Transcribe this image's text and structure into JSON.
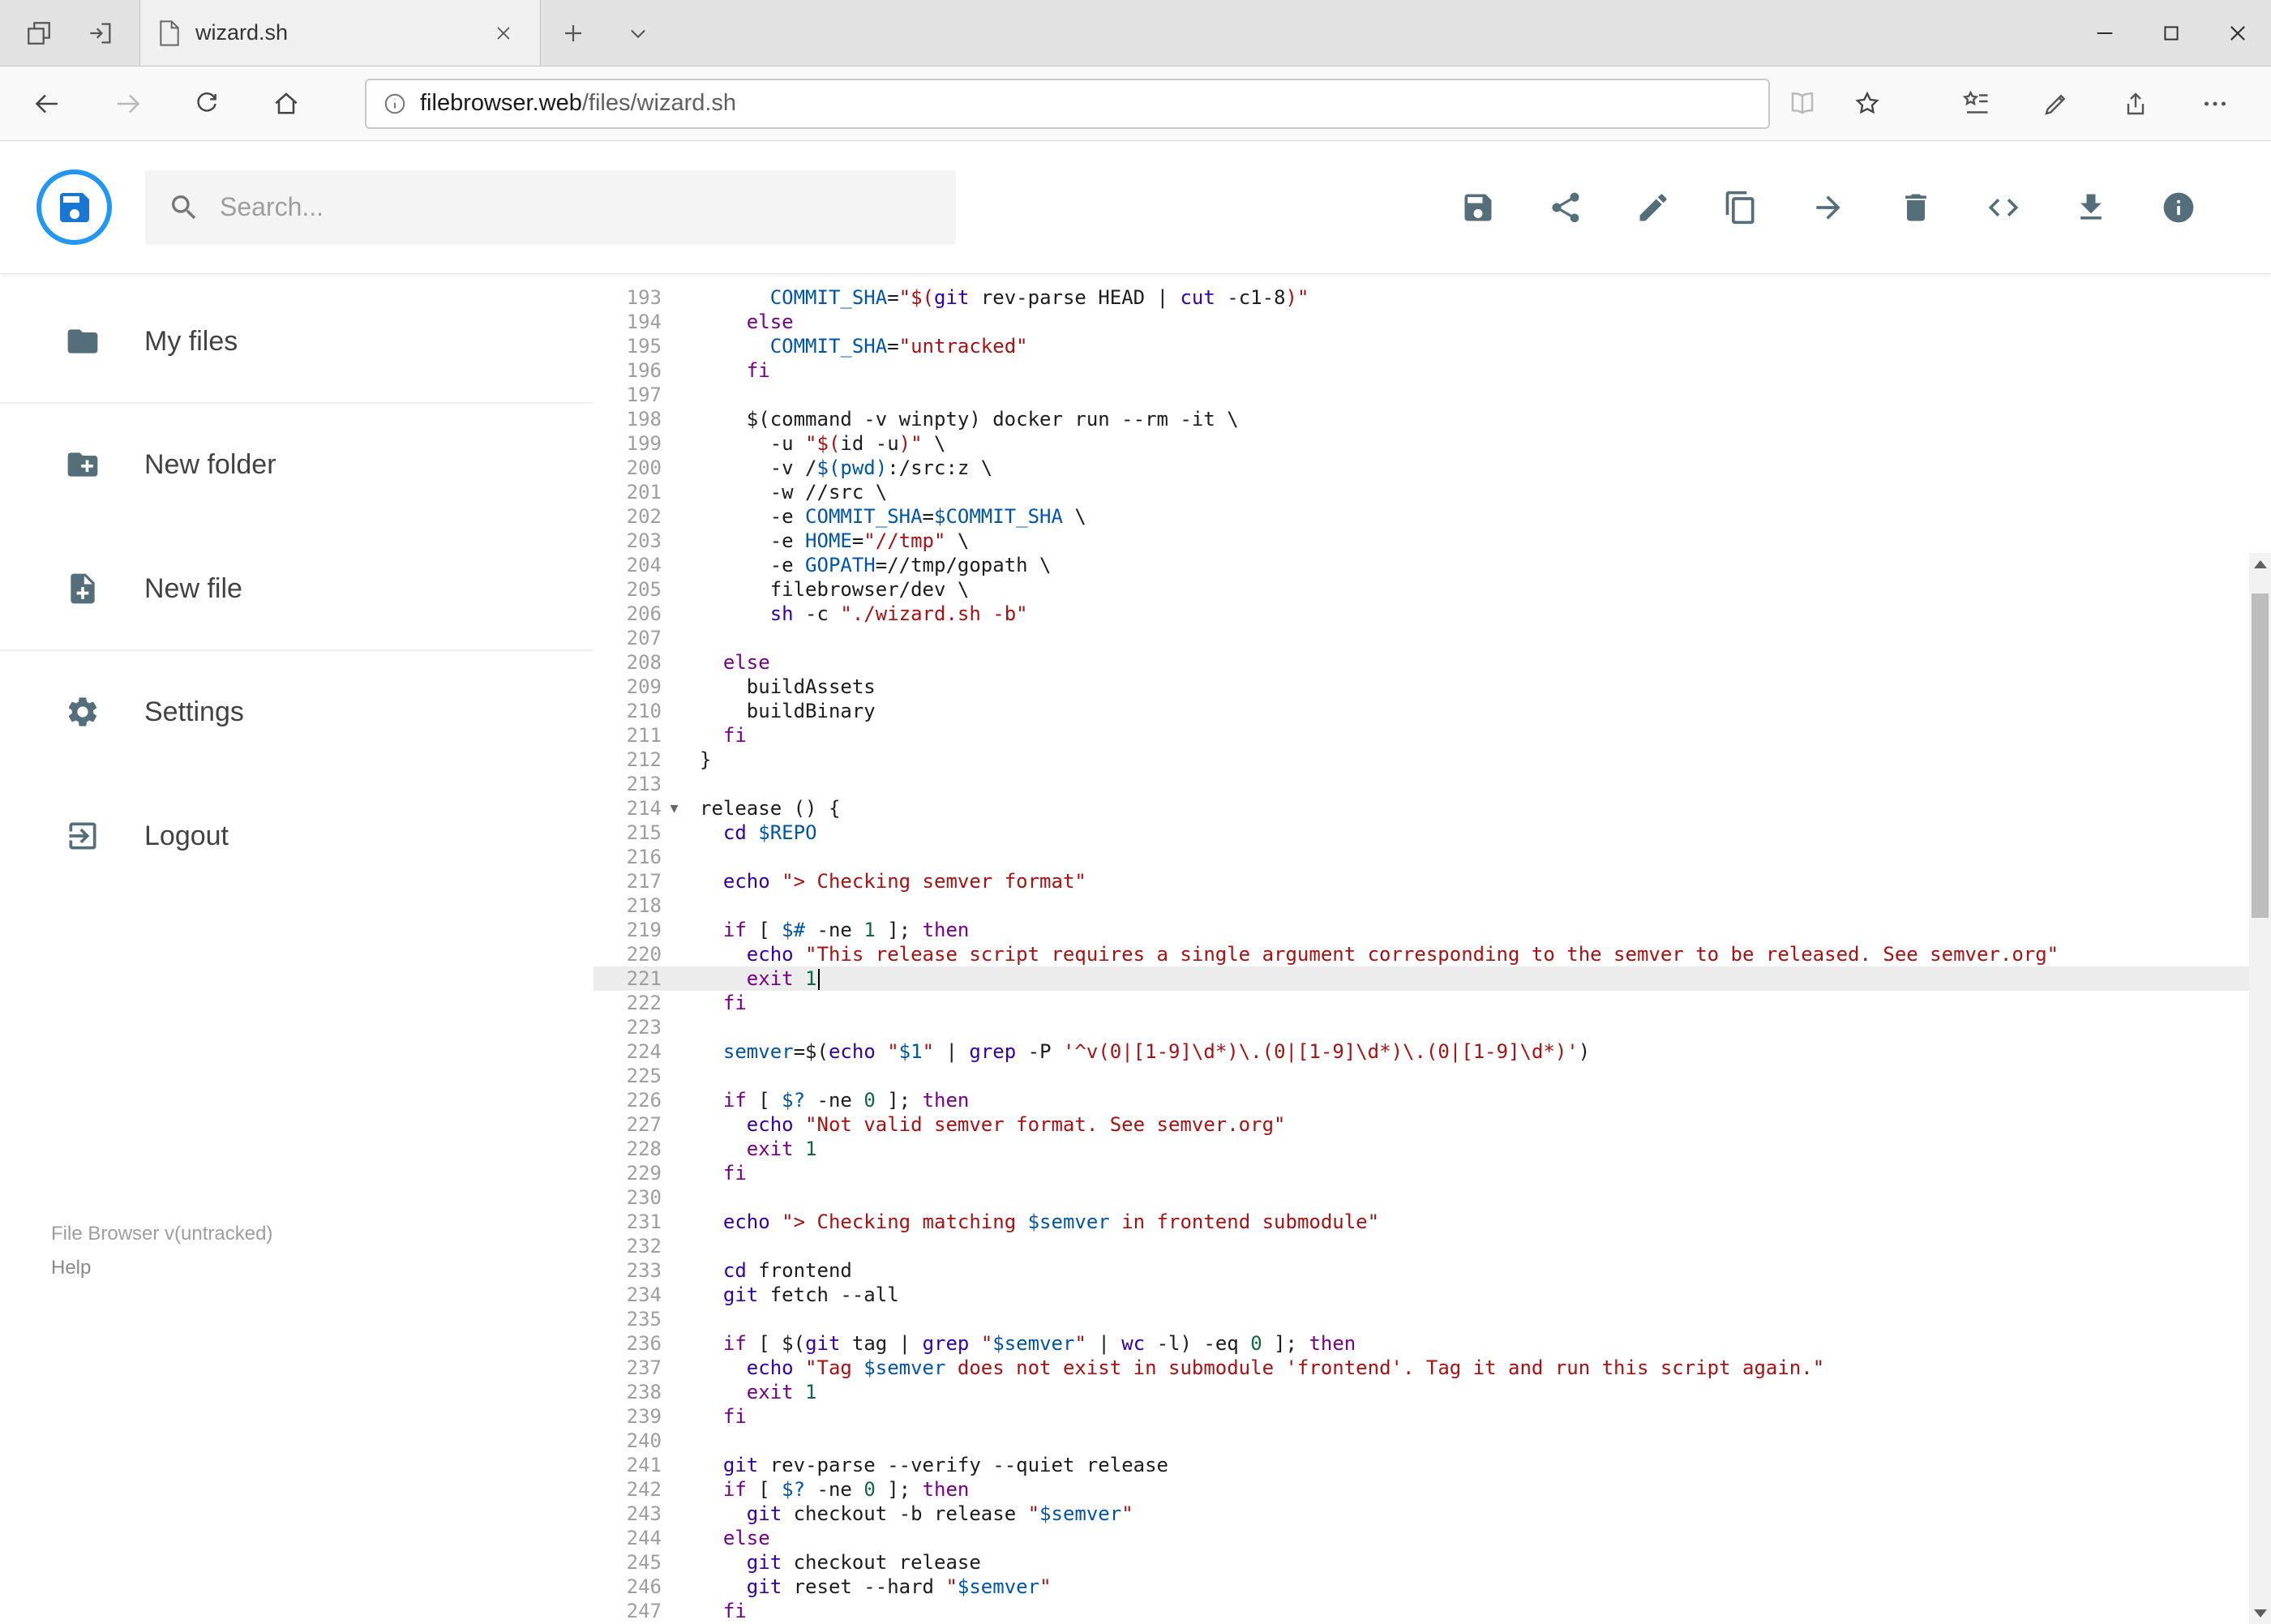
{
  "browser": {
    "tab_title": "wizard.sh",
    "url_domain": "filebrowser.web",
    "url_path": "/files/wizard.sh",
    "window_buttons": [
      "minimize",
      "maximize",
      "close"
    ],
    "nav_buttons": [
      "back",
      "forward",
      "refresh",
      "home"
    ],
    "right_buttons": [
      "reading-view",
      "add-favorite",
      "hub-favorites",
      "web-note",
      "share",
      "more"
    ]
  },
  "header": {
    "search_placeholder": "Search...",
    "actions": [
      "save",
      "share",
      "edit",
      "copy",
      "move",
      "delete",
      "view-source",
      "download",
      "info"
    ],
    "accent_color": "#2196f3",
    "icon_color": "#546e7a"
  },
  "sidebar": {
    "items": [
      {
        "label": "My files",
        "icon": "folder"
      },
      {
        "label": "New folder",
        "icon": "create-new-folder"
      },
      {
        "label": "New file",
        "icon": "new-file"
      },
      {
        "label": "Settings",
        "icon": "settings"
      },
      {
        "label": "Logout",
        "icon": "logout"
      }
    ],
    "version": "File Browser v(untracked)",
    "help": "Help"
  },
  "editor": {
    "language": "shell",
    "active_line": 221,
    "cursor_line": 221,
    "fold_marker": "▾",
    "lines": [
      {
        "n": 193,
        "tokens": [
          [
            "pl",
            "      "
          ],
          [
            "var",
            "COMMIT_SHA"
          ],
          [
            "pl",
            "="
          ],
          [
            "str",
            "\"$("
          ],
          [
            "bi",
            "git"
          ],
          [
            "pl",
            " rev-parse HEAD | "
          ],
          [
            "bi",
            "cut"
          ],
          [
            "pl",
            " -c1-8"
          ],
          [
            "str",
            ")\""
          ]
        ]
      },
      {
        "n": 194,
        "tokens": [
          [
            "pl",
            "    "
          ],
          [
            "kw",
            "else"
          ]
        ]
      },
      {
        "n": 195,
        "tokens": [
          [
            "pl",
            "      "
          ],
          [
            "var",
            "COMMIT_SHA"
          ],
          [
            "pl",
            "="
          ],
          [
            "str",
            "\"untracked\""
          ]
        ]
      },
      {
        "n": 196,
        "tokens": [
          [
            "pl",
            "    "
          ],
          [
            "kw",
            "fi"
          ]
        ]
      },
      {
        "n": 197,
        "tokens": []
      },
      {
        "n": 198,
        "tokens": [
          [
            "pl",
            "    $(command -v winpty) docker run --rm -it \\"
          ]
        ]
      },
      {
        "n": 199,
        "tokens": [
          [
            "pl",
            "      -u "
          ],
          [
            "str",
            "\"$("
          ],
          [
            "pl",
            "id -u"
          ],
          [
            "str",
            ")\""
          ],
          [
            "pl",
            " \\"
          ]
        ]
      },
      {
        "n": 200,
        "tokens": [
          [
            "pl",
            "      -v /"
          ],
          [
            "var",
            "$(pwd)"
          ],
          [
            "pl",
            ":/src:z \\"
          ]
        ]
      },
      {
        "n": 201,
        "tokens": [
          [
            "pl",
            "      -w //src \\"
          ]
        ]
      },
      {
        "n": 202,
        "tokens": [
          [
            "pl",
            "      -e "
          ],
          [
            "var",
            "COMMIT_SHA"
          ],
          [
            "pl",
            "="
          ],
          [
            "var",
            "$COMMIT_SHA"
          ],
          [
            "pl",
            " \\"
          ]
        ]
      },
      {
        "n": 203,
        "tokens": [
          [
            "pl",
            "      -e "
          ],
          [
            "var",
            "HOME"
          ],
          [
            "pl",
            "="
          ],
          [
            "str",
            "\"//tmp\""
          ],
          [
            "pl",
            " \\"
          ]
        ]
      },
      {
        "n": 204,
        "tokens": [
          [
            "pl",
            "      -e "
          ],
          [
            "var",
            "GOPATH"
          ],
          [
            "pl",
            "=//tmp/gopath \\"
          ]
        ]
      },
      {
        "n": 205,
        "tokens": [
          [
            "pl",
            "      filebrowser/dev \\"
          ]
        ]
      },
      {
        "n": 206,
        "tokens": [
          [
            "pl",
            "      "
          ],
          [
            "bi",
            "sh"
          ],
          [
            "pl",
            " -c "
          ],
          [
            "str",
            "\"./wizard.sh -b\""
          ]
        ]
      },
      {
        "n": 207,
        "tokens": []
      },
      {
        "n": 208,
        "tokens": [
          [
            "pl",
            "  "
          ],
          [
            "kw",
            "else"
          ]
        ]
      },
      {
        "n": 209,
        "tokens": [
          [
            "pl",
            "    buildAssets"
          ]
        ]
      },
      {
        "n": 210,
        "tokens": [
          [
            "pl",
            "    buildBinary"
          ]
        ]
      },
      {
        "n": 211,
        "tokens": [
          [
            "pl",
            "  "
          ],
          [
            "kw",
            "fi"
          ]
        ]
      },
      {
        "n": 212,
        "tokens": [
          [
            "pl",
            "}"
          ]
        ]
      },
      {
        "n": 213,
        "tokens": []
      },
      {
        "n": 214,
        "fold": true,
        "tokens": [
          [
            "pl",
            "release () {"
          ]
        ]
      },
      {
        "n": 215,
        "tokens": [
          [
            "pl",
            "  "
          ],
          [
            "bi",
            "cd"
          ],
          [
            "pl",
            " "
          ],
          [
            "var",
            "$REPO"
          ]
        ]
      },
      {
        "n": 216,
        "tokens": []
      },
      {
        "n": 217,
        "tokens": [
          [
            "pl",
            "  "
          ],
          [
            "bi",
            "echo"
          ],
          [
            "pl",
            " "
          ],
          [
            "str",
            "\"> Checking semver format\""
          ]
        ]
      },
      {
        "n": 218,
        "tokens": []
      },
      {
        "n": 219,
        "tokens": [
          [
            "pl",
            "  "
          ],
          [
            "kw",
            "if"
          ],
          [
            "pl",
            " [ "
          ],
          [
            "var",
            "$#"
          ],
          [
            "pl",
            " -ne "
          ],
          [
            "num",
            "1"
          ],
          [
            "pl",
            " ]; "
          ],
          [
            "kw",
            "then"
          ]
        ]
      },
      {
        "n": 220,
        "tokens": [
          [
            "pl",
            "    "
          ],
          [
            "bi",
            "echo"
          ],
          [
            "pl",
            " "
          ],
          [
            "str",
            "\"This release script requires a single argument corresponding to the semver to be released. See semver.org\""
          ]
        ]
      },
      {
        "n": 221,
        "tokens": [
          [
            "pl",
            "    "
          ],
          [
            "kw",
            "exit"
          ],
          [
            "pl",
            " "
          ],
          [
            "num",
            "1"
          ]
        ]
      },
      {
        "n": 222,
        "tokens": [
          [
            "pl",
            "  "
          ],
          [
            "kw",
            "fi"
          ]
        ]
      },
      {
        "n": 223,
        "tokens": []
      },
      {
        "n": 224,
        "tokens": [
          [
            "pl",
            "  "
          ],
          [
            "var",
            "semver"
          ],
          [
            "pl",
            "=$("
          ],
          [
            "bi",
            "echo"
          ],
          [
            "pl",
            " "
          ],
          [
            "str",
            "\""
          ],
          [
            "var",
            "$1"
          ],
          [
            "str",
            "\""
          ],
          [
            "pl",
            " | "
          ],
          [
            "bi",
            "grep"
          ],
          [
            "pl",
            " -P "
          ],
          [
            "str",
            "'^v(0|[1-9]\\d*)\\.(0|[1-9]\\d*)\\.(0|[1-9]\\d*)'"
          ],
          [
            "pl",
            ")"
          ]
        ]
      },
      {
        "n": 225,
        "tokens": []
      },
      {
        "n": 226,
        "tokens": [
          [
            "pl",
            "  "
          ],
          [
            "kw",
            "if"
          ],
          [
            "pl",
            " [ "
          ],
          [
            "var",
            "$?"
          ],
          [
            "pl",
            " -ne "
          ],
          [
            "num",
            "0"
          ],
          [
            "pl",
            " ]; "
          ],
          [
            "kw",
            "then"
          ]
        ]
      },
      {
        "n": 227,
        "tokens": [
          [
            "pl",
            "    "
          ],
          [
            "bi",
            "echo"
          ],
          [
            "pl",
            " "
          ],
          [
            "str",
            "\"Not valid semver format. See semver.org\""
          ]
        ]
      },
      {
        "n": 228,
        "tokens": [
          [
            "pl",
            "    "
          ],
          [
            "kw",
            "exit"
          ],
          [
            "pl",
            " "
          ],
          [
            "num",
            "1"
          ]
        ]
      },
      {
        "n": 229,
        "tokens": [
          [
            "pl",
            "  "
          ],
          [
            "kw",
            "fi"
          ]
        ]
      },
      {
        "n": 230,
        "tokens": []
      },
      {
        "n": 231,
        "tokens": [
          [
            "pl",
            "  "
          ],
          [
            "bi",
            "echo"
          ],
          [
            "pl",
            " "
          ],
          [
            "str",
            "\"> Checking matching "
          ],
          [
            "var",
            "$semver"
          ],
          [
            "str",
            " in frontend submodule\""
          ]
        ]
      },
      {
        "n": 232,
        "tokens": []
      },
      {
        "n": 233,
        "tokens": [
          [
            "pl",
            "  "
          ],
          [
            "bi",
            "cd"
          ],
          [
            "pl",
            " frontend"
          ]
        ]
      },
      {
        "n": 234,
        "tokens": [
          [
            "pl",
            "  "
          ],
          [
            "bi",
            "git"
          ],
          [
            "pl",
            " fetch --all"
          ]
        ]
      },
      {
        "n": 235,
        "tokens": []
      },
      {
        "n": 236,
        "tokens": [
          [
            "pl",
            "  "
          ],
          [
            "kw",
            "if"
          ],
          [
            "pl",
            " [ $("
          ],
          [
            "bi",
            "git"
          ],
          [
            "pl",
            " tag | "
          ],
          [
            "bi",
            "grep"
          ],
          [
            "pl",
            " "
          ],
          [
            "str",
            "\""
          ],
          [
            "var",
            "$semver"
          ],
          [
            "str",
            "\""
          ],
          [
            "pl",
            " | "
          ],
          [
            "bi",
            "wc"
          ],
          [
            "pl",
            " -l) -eq "
          ],
          [
            "num",
            "0"
          ],
          [
            "pl",
            " ]; "
          ],
          [
            "kw",
            "then"
          ]
        ]
      },
      {
        "n": 237,
        "tokens": [
          [
            "pl",
            "    "
          ],
          [
            "bi",
            "echo"
          ],
          [
            "pl",
            " "
          ],
          [
            "str",
            "\"Tag "
          ],
          [
            "var",
            "$semver"
          ],
          [
            "str",
            " does not exist in submodule 'frontend'. Tag it and run this script again.\""
          ]
        ]
      },
      {
        "n": 238,
        "tokens": [
          [
            "pl",
            "    "
          ],
          [
            "kw",
            "exit"
          ],
          [
            "pl",
            " "
          ],
          [
            "num",
            "1"
          ]
        ]
      },
      {
        "n": 239,
        "tokens": [
          [
            "pl",
            "  "
          ],
          [
            "kw",
            "fi"
          ]
        ]
      },
      {
        "n": 240,
        "tokens": []
      },
      {
        "n": 241,
        "tokens": [
          [
            "pl",
            "  "
          ],
          [
            "bi",
            "git"
          ],
          [
            "pl",
            " rev-parse --verify --quiet release"
          ]
        ]
      },
      {
        "n": 242,
        "tokens": [
          [
            "pl",
            "  "
          ],
          [
            "kw",
            "if"
          ],
          [
            "pl",
            " [ "
          ],
          [
            "var",
            "$?"
          ],
          [
            "pl",
            " -ne "
          ],
          [
            "num",
            "0"
          ],
          [
            "pl",
            " ]; "
          ],
          [
            "kw",
            "then"
          ]
        ]
      },
      {
        "n": 243,
        "tokens": [
          [
            "pl",
            "    "
          ],
          [
            "bi",
            "git"
          ],
          [
            "pl",
            " checkout -b release "
          ],
          [
            "str",
            "\""
          ],
          [
            "var",
            "$semver"
          ],
          [
            "str",
            "\""
          ]
        ]
      },
      {
        "n": 244,
        "tokens": [
          [
            "pl",
            "  "
          ],
          [
            "kw",
            "else"
          ]
        ]
      },
      {
        "n": 245,
        "tokens": [
          [
            "pl",
            "    "
          ],
          [
            "bi",
            "git"
          ],
          [
            "pl",
            " checkout release"
          ]
        ]
      },
      {
        "n": 246,
        "tokens": [
          [
            "pl",
            "    "
          ],
          [
            "bi",
            "git"
          ],
          [
            "pl",
            " reset --hard "
          ],
          [
            "str",
            "\""
          ],
          [
            "var",
            "$semver"
          ],
          [
            "str",
            "\""
          ]
        ]
      },
      {
        "n": 247,
        "tokens": [
          [
            "pl",
            "  "
          ],
          [
            "kw",
            "fi"
          ]
        ]
      }
    ]
  }
}
